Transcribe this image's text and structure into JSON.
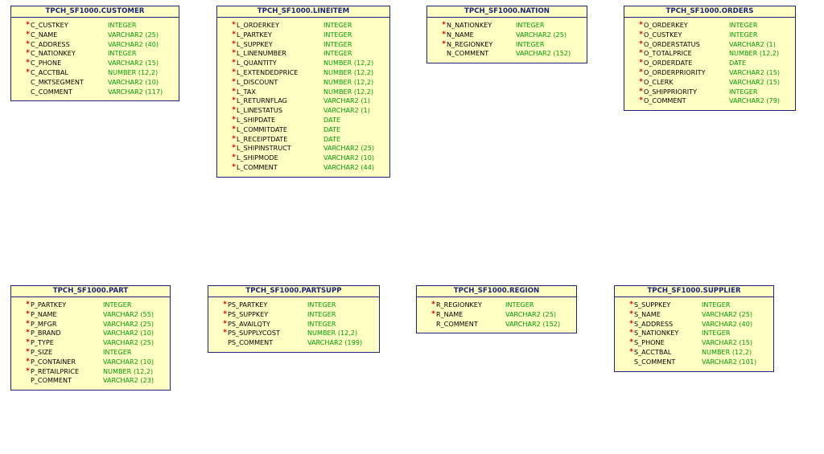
{
  "colors": {
    "border": "#1a237e",
    "fill": "#ffffc4",
    "title": "#1a237e",
    "type": "#009900",
    "required_marker": "#dd0000"
  },
  "tables": [
    {
      "title": "TPCH_SF1000.CUSTOMER",
      "columns": [
        {
          "name": "C_CUSTKEY",
          "type": "INTEGER",
          "mark": "*"
        },
        {
          "name": "C_NAME",
          "type": "VARCHAR2 (25)",
          "mark": "*"
        },
        {
          "name": "C_ADDRESS",
          "type": "VARCHAR2 (40)",
          "mark": "*"
        },
        {
          "name": "C_NATIONKEY",
          "type": "INTEGER",
          "mark": "*"
        },
        {
          "name": "C_PHONE",
          "type": "VARCHAR2 (15)",
          "mark": "*"
        },
        {
          "name": "C_ACCTBAL",
          "type": "NUMBER (12,2)",
          "mark": "*"
        },
        {
          "name": "C_MKTSEGMENT",
          "type": "VARCHAR2 (10)",
          "mark": ""
        },
        {
          "name": "C_COMMENT",
          "type": "VARCHAR2 (117)",
          "mark": ""
        }
      ]
    },
    {
      "title": "TPCH_SF1000.LINEITEM",
      "columns": [
        {
          "name": "L_ORDERKEY",
          "type": "INTEGER",
          "mark": "*"
        },
        {
          "name": "L_PARTKEY",
          "type": "INTEGER",
          "mark": "*"
        },
        {
          "name": "L_SUPPKEY",
          "type": "INTEGER",
          "mark": "*"
        },
        {
          "name": "L_LINENUMBER",
          "type": "INTEGER",
          "mark": "*"
        },
        {
          "name": "L_QUANTITY",
          "type": "NUMBER (12,2)",
          "mark": "*"
        },
        {
          "name": "L_EXTENDEDPRICE",
          "type": "NUMBER (12,2)",
          "mark": "*"
        },
        {
          "name": "L_DISCOUNT",
          "type": "NUMBER (12,2)",
          "mark": "*"
        },
        {
          "name": "L_TAX",
          "type": "NUMBER (12,2)",
          "mark": "*"
        },
        {
          "name": "L_RETURNFLAG",
          "type": "VARCHAR2 (1)",
          "mark": "*"
        },
        {
          "name": "L_LINESTATUS",
          "type": "VARCHAR2 (1)",
          "mark": "*"
        },
        {
          "name": "L_SHIPDATE",
          "type": "DATE",
          "mark": "*"
        },
        {
          "name": "L_COMMITDATE",
          "type": "DATE",
          "mark": "*"
        },
        {
          "name": "L_RECEIPTDATE",
          "type": "DATE",
          "mark": "*"
        },
        {
          "name": "L_SHIPINSTRUCT",
          "type": "VARCHAR2 (25)",
          "mark": "*"
        },
        {
          "name": "L_SHIPMODE",
          "type": "VARCHAR2 (10)",
          "mark": "*"
        },
        {
          "name": "L_COMMENT",
          "type": "VARCHAR2 (44)",
          "mark": "*"
        }
      ]
    },
    {
      "title": "TPCH_SF1000.NATION",
      "columns": [
        {
          "name": "N_NATIONKEY",
          "type": "INTEGER",
          "mark": "*"
        },
        {
          "name": "N_NAME",
          "type": "VARCHAR2 (25)",
          "mark": "*"
        },
        {
          "name": "N_REGIONKEY",
          "type": "INTEGER",
          "mark": "*"
        },
        {
          "name": "N_COMMENT",
          "type": "VARCHAR2 (152)",
          "mark": ""
        }
      ]
    },
    {
      "title": "TPCH_SF1000.ORDERS",
      "columns": [
        {
          "name": "O_ORDERKEY",
          "type": "INTEGER",
          "mark": "*"
        },
        {
          "name": "O_CUSTKEY",
          "type": "INTEGER",
          "mark": "*"
        },
        {
          "name": "O_ORDERSTATUS",
          "type": "VARCHAR2 (1)",
          "mark": "*"
        },
        {
          "name": "O_TOTALPRICE",
          "type": "NUMBER (12,2)",
          "mark": "*"
        },
        {
          "name": "O_ORDERDATE",
          "type": "DATE",
          "mark": "*"
        },
        {
          "name": "O_ORDERPRIORITY",
          "type": "VARCHAR2 (15)",
          "mark": "*"
        },
        {
          "name": "O_CLERK",
          "type": "VARCHAR2 (15)",
          "mark": "*"
        },
        {
          "name": "O_SHIPPRIORITY",
          "type": "INTEGER",
          "mark": "*"
        },
        {
          "name": "O_COMMENT",
          "type": "VARCHAR2 (79)",
          "mark": "*"
        }
      ]
    },
    {
      "title": "TPCH_SF1000.PART",
      "columns": [
        {
          "name": "P_PARTKEY",
          "type": "INTEGER",
          "mark": "*"
        },
        {
          "name": "P_NAME",
          "type": "VARCHAR2 (55)",
          "mark": "*"
        },
        {
          "name": "P_MFGR",
          "type": "VARCHAR2 (25)",
          "mark": "*"
        },
        {
          "name": "P_BRAND",
          "type": "VARCHAR2 (10)",
          "mark": "*"
        },
        {
          "name": "P_TYPE",
          "type": "VARCHAR2 (25)",
          "mark": "*"
        },
        {
          "name": "P_SIZE",
          "type": "INTEGER",
          "mark": "*"
        },
        {
          "name": "P_CONTAINER",
          "type": "VARCHAR2 (10)",
          "mark": "*"
        },
        {
          "name": "P_RETAILPRICE",
          "type": "NUMBER (12,2)",
          "mark": "*"
        },
        {
          "name": "P_COMMENT",
          "type": "VARCHAR2 (23)",
          "mark": ""
        }
      ]
    },
    {
      "title": "TPCH_SF1000.PARTSUPP",
      "columns": [
        {
          "name": "PS_PARTKEY",
          "type": "INTEGER",
          "mark": "*"
        },
        {
          "name": "PS_SUPPKEY",
          "type": "INTEGER",
          "mark": "*"
        },
        {
          "name": "PS_AVAILQTY",
          "type": "INTEGER",
          "mark": "*"
        },
        {
          "name": "PS_SUPPLYCOST",
          "type": "NUMBER (12,2)",
          "mark": "*"
        },
        {
          "name": "PS_COMMENT",
          "type": "VARCHAR2 (199)",
          "mark": ""
        }
      ]
    },
    {
      "title": "TPCH_SF1000.REGION",
      "columns": [
        {
          "name": "R_REGIONKEY",
          "type": "INTEGER",
          "mark": "*"
        },
        {
          "name": "R_NAME",
          "type": "VARCHAR2 (25)",
          "mark": "*"
        },
        {
          "name": "R_COMMENT",
          "type": "VARCHAR2 (152)",
          "mark": ""
        }
      ]
    },
    {
      "title": "TPCH_SF1000.SUPPLIER",
      "columns": [
        {
          "name": "S_SUPPKEY",
          "type": "INTEGER",
          "mark": "*"
        },
        {
          "name": "S_NAME",
          "type": "VARCHAR2 (25)",
          "mark": "*"
        },
        {
          "name": "S_ADDRESS",
          "type": "VARCHAR2 (40)",
          "mark": "*"
        },
        {
          "name": "S_NATIONKEY",
          "type": "INTEGER",
          "mark": "*"
        },
        {
          "name": "S_PHONE",
          "type": "VARCHAR2 (15)",
          "mark": "*"
        },
        {
          "name": "S_ACCTBAL",
          "type": "NUMBER (12,2)",
          "mark": "*"
        },
        {
          "name": "S_COMMENT",
          "type": "VARCHAR2 (101)",
          "mark": ""
        }
      ]
    }
  ]
}
